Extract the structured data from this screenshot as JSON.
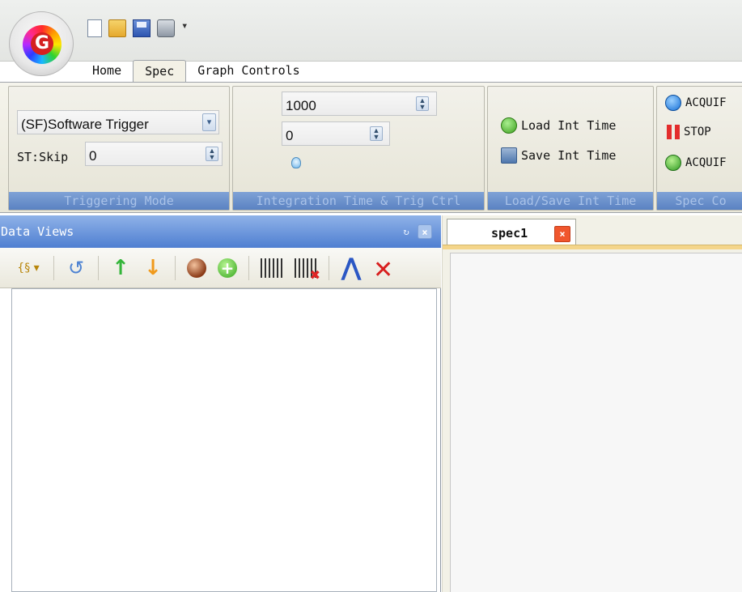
{
  "app": {
    "logo_letter": "G"
  },
  "qat": {
    "items": [
      "new-icon",
      "open-icon",
      "save-icon",
      "print-icon",
      "customize-icon"
    ],
    "more_glyph": "▾"
  },
  "tabs": [
    {
      "label": "Home"
    },
    {
      "label": "Spec",
      "active": true
    },
    {
      "label": "Graph Controls"
    }
  ],
  "ribbon": {
    "triggering": {
      "caption": "Triggering Mode",
      "mode_value": "(SF)Software Trigger",
      "skip_label": "ST:Skip",
      "skip_value": "0"
    },
    "integration": {
      "caption": "Integration Time & Trig Ctrl",
      "int_time_value": "1000",
      "trig_value": "0"
    },
    "loadsave": {
      "caption": "Load/Save Int Time",
      "load_label": "Load Int Time",
      "save_label": "Save Int Time"
    },
    "spec_control": {
      "caption": "Spec Co",
      "acquire_label": "ACQUIF",
      "stop_label": "STOP",
      "acquire2_label": "ACQUIF"
    }
  },
  "data_views": {
    "title": "Data Views",
    "pin_glyph": "↻",
    "close_glyph": "×",
    "toolbar": [
      "tag-icon",
      "undo-icon",
      "move-up-icon",
      "move-down-icon",
      "ball-icon",
      "add-icon",
      "spectrum-icon",
      "clear-spectrum-icon",
      "peak-icon",
      "clear-peak-icon"
    ]
  },
  "document": {
    "tab_label": "spec1",
    "close_glyph": "×"
  },
  "colors": {
    "panel_header": "#5a86d4",
    "ribbon_caption": "#6a90cc",
    "doc_tab_strip": "#f4d58a",
    "close_red": "#f0562d"
  }
}
